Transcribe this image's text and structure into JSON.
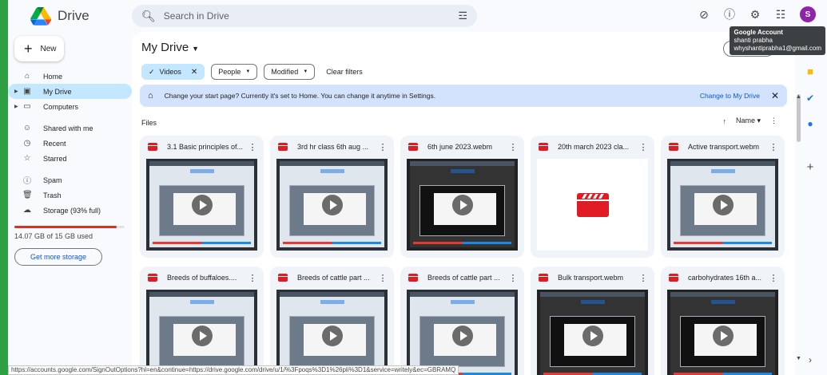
{
  "app": {
    "name": "Drive"
  },
  "search": {
    "placeholder": "Search in Drive"
  },
  "account": {
    "avatar_letter": "S",
    "tooltip_title": "Google Account",
    "tooltip_name": "shanti prabha",
    "tooltip_email": "whyshantiprabha1@gmail.com"
  },
  "sidebar": {
    "new_label": "New",
    "items": [
      {
        "label": "Home",
        "icon": "home-icon"
      },
      {
        "label": "My Drive",
        "icon": "my-drive-icon"
      },
      {
        "label": "Computers",
        "icon": "computers-icon"
      },
      {
        "label": "Shared with me",
        "icon": "shared-icon"
      },
      {
        "label": "Recent",
        "icon": "clock-icon"
      },
      {
        "label": "Starred",
        "icon": "star-icon"
      },
      {
        "label": "Spam",
        "icon": "spam-icon"
      },
      {
        "label": "Trash",
        "icon": "trash-icon"
      },
      {
        "label": "Storage (93% full)",
        "icon": "cloud-icon"
      }
    ],
    "storage_used_fraction": 0.93,
    "storage_text": "14.07 GB of 15 GB used",
    "get_storage_label": "Get more storage"
  },
  "main": {
    "title": "My Drive",
    "filters": {
      "type": "Videos",
      "people": "People",
      "modified": "Modified",
      "clear": "Clear filters"
    },
    "banner": {
      "lead": "Change your start page?",
      "text": "Currently it's set to Home. You can change it anytime in Settings.",
      "action": "Change to My Drive"
    },
    "files_label": "Files",
    "sort_label": "Name",
    "files": [
      {
        "name": "3.1 Basic principles of...",
        "thumb": "screen"
      },
      {
        "name": "3rd hr class 6th aug ...",
        "thumb": "screen"
      },
      {
        "name": "6th june 2023.webm",
        "thumb": "dark"
      },
      {
        "name": "20th march 2023 cla...",
        "thumb": "placeholder"
      },
      {
        "name": "Active transport.webm",
        "thumb": "screen"
      },
      {
        "name": "Breeds of buffaloes....",
        "thumb": "screen"
      },
      {
        "name": "Breeds of cattle part ...",
        "thumb": "screen"
      },
      {
        "name": "Breeds of cattle part ...",
        "thumb": "screen"
      },
      {
        "name": "Bulk transport.webm",
        "thumb": "dark"
      },
      {
        "name": "carbohydrates 16th a...",
        "thumb": "dark"
      }
    ]
  },
  "status_bar": {
    "url": "https://accounts.google.com/SignOutOptions?hl=en&continue=https://drive.google.com/drive/u/1/%3Fpoqs%3D1%26pli%3D1&service=writely&ec=GBRAMQ"
  },
  "colors": {
    "accent_blue": "#0b57d0",
    "selected_nav": "#c2e7ff",
    "storage_red": "#d93025",
    "video_red": "#e01b24"
  }
}
